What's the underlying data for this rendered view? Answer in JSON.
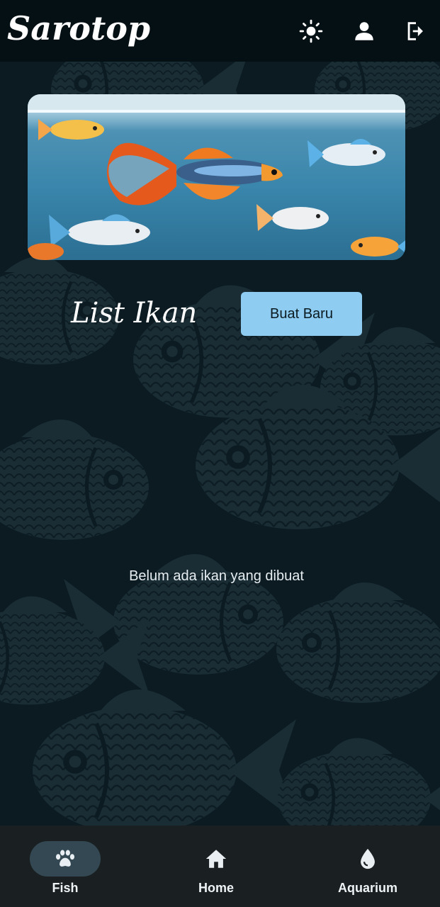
{
  "app": {
    "brand": "Sarotop"
  },
  "header_actions": [
    {
      "icon": "sun-icon",
      "name": "theme-toggle"
    },
    {
      "icon": "person-icon",
      "name": "profile"
    },
    {
      "icon": "logout-icon",
      "name": "logout"
    }
  ],
  "fish_list": {
    "title": "List Ikan",
    "create_button": "Buat Baru",
    "empty_message": "Belum ada ikan yang dibuat"
  },
  "bottom_nav": {
    "items": [
      {
        "label": "Fish",
        "icon": "paw-icon",
        "active": true
      },
      {
        "label": "Home",
        "icon": "home-icon",
        "active": false
      },
      {
        "label": "Aquarium",
        "icon": "water-drop-icon",
        "active": false
      }
    ]
  },
  "colors": {
    "app_bar": "#051015",
    "background": "#0b1b21",
    "button_accent": "#8ecdf1",
    "nav_bar": "#1a2022",
    "nav_active_pill": "#334852"
  }
}
